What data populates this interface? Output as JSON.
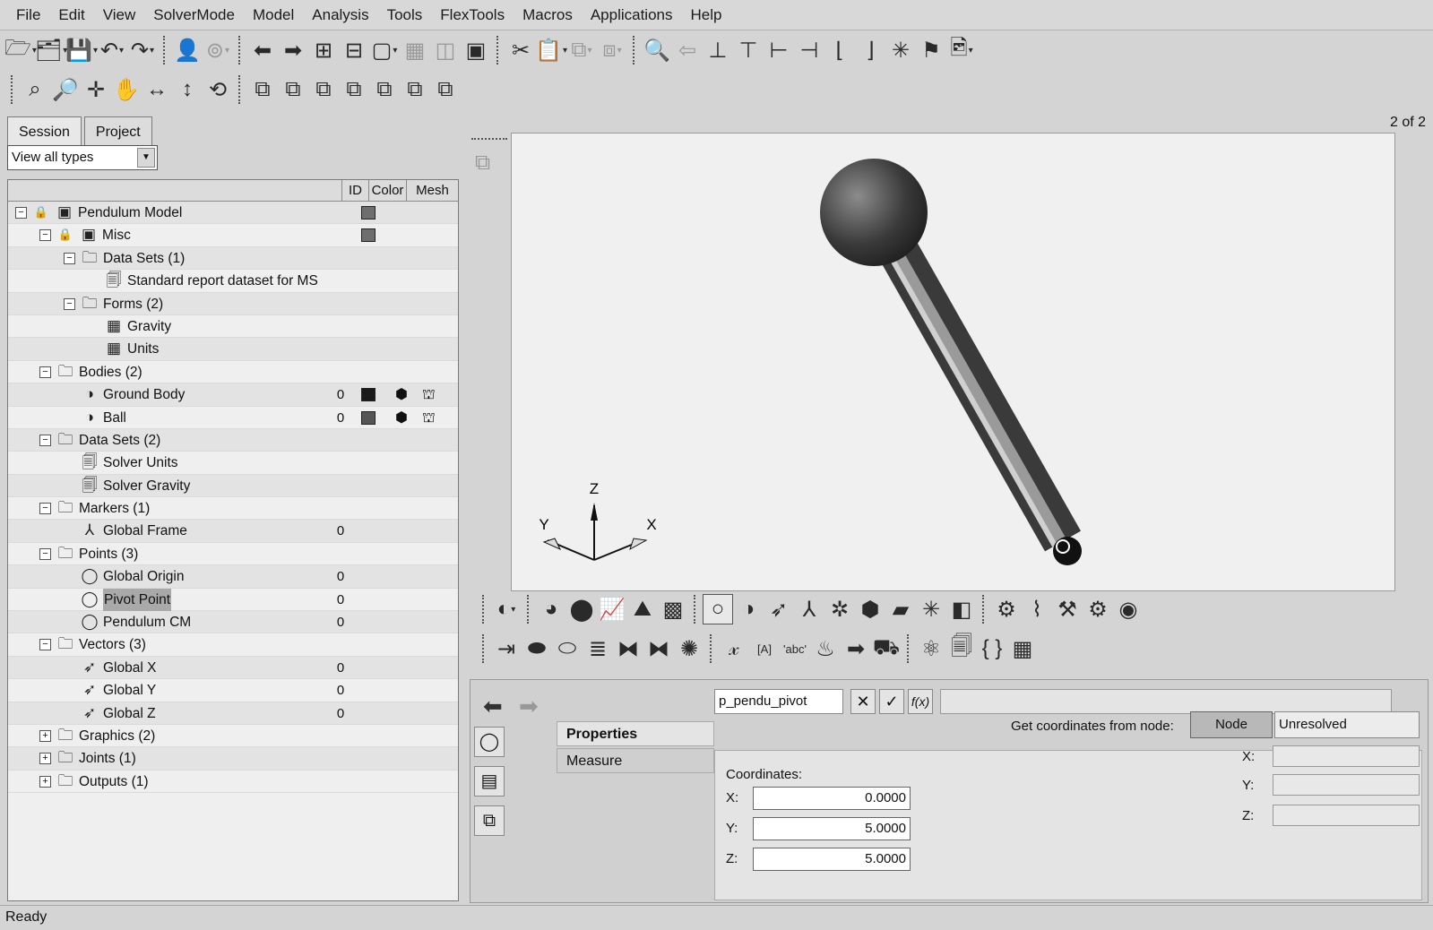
{
  "menu": [
    "File",
    "Edit",
    "View",
    "SolverMode",
    "Model",
    "Analysis",
    "Tools",
    "FlexTools",
    "Macros",
    "Applications",
    "Help"
  ],
  "left_panel": {
    "tabs": [
      "Session",
      "Project"
    ],
    "filter": "View all types",
    "columns": {
      "id": "ID",
      "color": "Color",
      "mesh": "Mesh"
    },
    "tree": [
      {
        "label": "Pendulum Model",
        "level": 0,
        "expander": "minus",
        "icon": "model-icon",
        "color": "#6e6e6e"
      },
      {
        "label": "Misc",
        "level": 1,
        "expander": "minus",
        "icon": "model-icon",
        "color": "#6e6e6e"
      },
      {
        "label": "Data Sets (1)",
        "level": 2,
        "expander": "minus",
        "icon": "folder-icon"
      },
      {
        "label": "Standard report dataset for MS",
        "level": 3,
        "icon": "dataset-icon"
      },
      {
        "label": "Forms (2)",
        "level": 2,
        "expander": "minus",
        "icon": "folder-icon"
      },
      {
        "label": "Gravity",
        "level": 3,
        "icon": "table-icon"
      },
      {
        "label": "Units",
        "level": 3,
        "icon": "table-icon"
      },
      {
        "label": "Bodies (2)",
        "level": 1,
        "expander": "minus",
        "icon": "folder-icon"
      },
      {
        "label": "Ground Body",
        "level": 2,
        "icon": "body-icon",
        "id": "0",
        "color": "#1a1a1a",
        "mesh": true
      },
      {
        "label": "Ball",
        "level": 2,
        "icon": "body-icon",
        "id": "0",
        "color": "#555555",
        "mesh": true
      },
      {
        "label": "Data Sets (2)",
        "level": 1,
        "expander": "minus",
        "icon": "folder-icon"
      },
      {
        "label": "Solver Units",
        "level": 2,
        "icon": "dataset-icon"
      },
      {
        "label": "Solver Gravity",
        "level": 2,
        "icon": "dataset-icon"
      },
      {
        "label": "Markers (1)",
        "level": 1,
        "expander": "minus",
        "icon": "folder-icon"
      },
      {
        "label": "Global Frame",
        "level": 2,
        "icon": "marker-icon",
        "id": "0"
      },
      {
        "label": "Points (3)",
        "level": 1,
        "expander": "minus",
        "icon": "folder-icon"
      },
      {
        "label": "Global Origin",
        "level": 2,
        "icon": "point-icon",
        "id": "0"
      },
      {
        "label": "Pivot Point",
        "level": 2,
        "icon": "point-icon",
        "id": "0",
        "selected": true
      },
      {
        "label": "Pendulum CM",
        "level": 2,
        "icon": "point-icon",
        "id": "0"
      },
      {
        "label": "Vectors (3)",
        "level": 1,
        "expander": "minus",
        "icon": "folder-icon"
      },
      {
        "label": "Global X",
        "level": 2,
        "icon": "vector-icon",
        "id": "0"
      },
      {
        "label": "Global Y",
        "level": 2,
        "icon": "vector-icon",
        "id": "0"
      },
      {
        "label": "Global Z",
        "level": 2,
        "icon": "vector-icon",
        "id": "0"
      },
      {
        "label": "Graphics (2)",
        "level": 1,
        "expander": "plus",
        "icon": "folder-icon"
      },
      {
        "label": "Joints (1)",
        "level": 1,
        "expander": "plus",
        "icon": "folder-icon"
      },
      {
        "label": "Outputs (1)",
        "level": 1,
        "expander": "plus",
        "icon": "folder-icon"
      }
    ]
  },
  "viewport": {
    "page_count": "2 of 2",
    "triad": {
      "z": "Z",
      "y": "Y",
      "x": "X"
    }
  },
  "property_panel": {
    "entity_name": "p_pendu_pivot",
    "tabs": [
      "Properties",
      "Measure"
    ],
    "coordinates_label": "Coordinates:",
    "coords": [
      {
        "axis": "X:",
        "value": "0.0000"
      },
      {
        "axis": "Y:",
        "value": "5.0000"
      },
      {
        "axis": "Z:",
        "value": "5.0000"
      }
    ],
    "node_label": "Get coordinates from node:",
    "node_button": "Node",
    "node_value": "Unresolved",
    "node_axes": [
      "X:",
      "Y:",
      "Z:"
    ]
  },
  "status": "Ready"
}
